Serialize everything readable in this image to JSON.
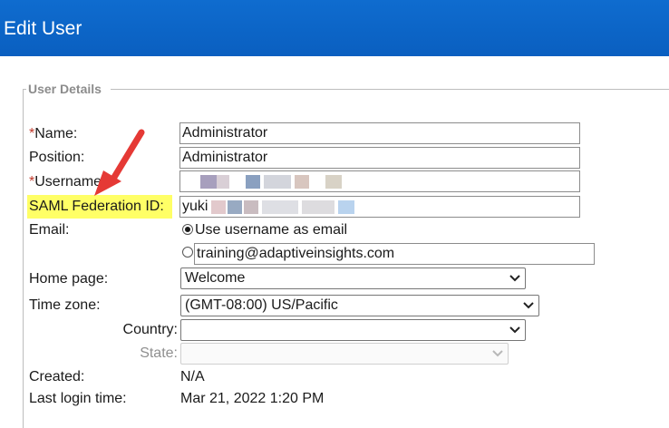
{
  "header": {
    "title": "Edit User"
  },
  "section": {
    "legend": "User Details"
  },
  "fields": {
    "name": {
      "required_mark": "*",
      "label": "Name:",
      "value": "Administrator"
    },
    "position": {
      "label": "Position:",
      "value": "Administrator"
    },
    "username": {
      "required_mark": "*",
      "label": "Username:",
      "value": ""
    },
    "saml": {
      "label": "SAML Federation ID:",
      "value": "yuki"
    },
    "email": {
      "label": "Email:",
      "option_username_label": "Use username as email",
      "option_username_selected": true,
      "custom_value": "training@adaptiveinsights.com"
    },
    "home_page": {
      "label": "Home page:",
      "selected": "Welcome"
    },
    "time_zone": {
      "label": "Time zone:",
      "selected": "(GMT-08:00) US/Pacific"
    },
    "country": {
      "label": "Country:",
      "selected": ""
    },
    "state": {
      "label": "State:",
      "selected": ""
    },
    "created": {
      "label": "Created:",
      "value": "N/A"
    },
    "last_login": {
      "label": "Last login time:",
      "value": "Mar 21, 2022 1:20 PM"
    }
  },
  "colors": {
    "header_bg": "#0a62c4",
    "highlight": "#ffff66",
    "required": "#c0392b",
    "annotation_arrow": "#e53935"
  },
  "icons": {
    "select_arrow": "chevron-down-icon",
    "annotation": "red-arrow-annotation"
  }
}
